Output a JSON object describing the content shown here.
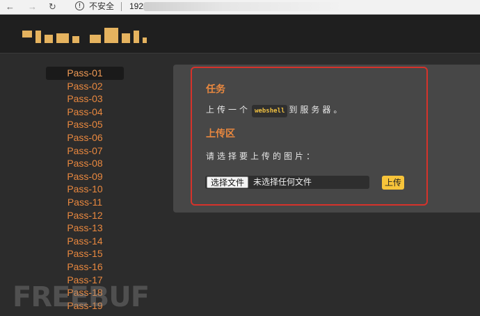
{
  "browser": {
    "back_icon": "arrow-left-icon",
    "forward_icon": "arrow-right-icon",
    "reload_icon": "reload-icon",
    "security_label": "不安全",
    "address_visible": "192"
  },
  "header": {
    "logo_icon": "pixelated-logo"
  },
  "sidebar": {
    "items": [
      {
        "label": "Pass-01"
      },
      {
        "label": "Pass-02"
      },
      {
        "label": "Pass-03"
      },
      {
        "label": "Pass-04"
      },
      {
        "label": "Pass-05"
      },
      {
        "label": "Pass-06"
      },
      {
        "label": "Pass-07"
      },
      {
        "label": "Pass-08"
      },
      {
        "label": "Pass-09"
      },
      {
        "label": "Pass-10"
      },
      {
        "label": "Pass-11"
      },
      {
        "label": "Pass-12"
      },
      {
        "label": "Pass-13"
      },
      {
        "label": "Pass-14"
      },
      {
        "label": "Pass-15"
      },
      {
        "label": "Pass-16"
      },
      {
        "label": "Pass-17"
      },
      {
        "label": "Pass-18"
      },
      {
        "label": "Pass-19"
      }
    ]
  },
  "main": {
    "task_heading": "任务",
    "task_prefix": "上传一个",
    "task_code": "webshell",
    "task_suffix": "到服务器。",
    "upload_heading": "上传区",
    "upload_prompt": "请选择要上传的图片：",
    "choose_file_label": "选择文件",
    "no_file_text": "未选择任何文件",
    "upload_label": "上传"
  },
  "colors": {
    "accent": "#e9883f",
    "highlight_box": "#d7322a",
    "upload_button": "#f7c43a"
  },
  "watermark": "FREEBUF"
}
